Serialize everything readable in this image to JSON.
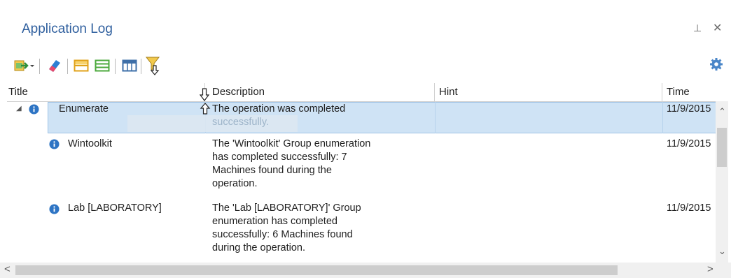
{
  "panel": {
    "title": "Application Log",
    "pin_glyph": "⊥",
    "close_glyph": "✕"
  },
  "toolbar": {
    "items": [
      "export-icon",
      "dropdown-arrow-icon",
      "eraser-icon",
      "collapse-rows-icon",
      "expand-rows-icon",
      "columns-icon",
      "filter-icon"
    ],
    "settings_icon": "gear-icon"
  },
  "grid": {
    "columns": {
      "title": "Title",
      "description": "Description",
      "hint": "Hint",
      "time": "Time"
    },
    "rows": [
      {
        "level": 0,
        "expanded": true,
        "selected": true,
        "icon": "info-icon",
        "title": "Enumerate",
        "description": [
          "The operation was completed",
          "successfully."
        ],
        "hint": "",
        "time": "11/9/2015"
      },
      {
        "level": 1,
        "icon": "info-icon",
        "title": "Wintoolkit",
        "description": [
          "The 'Wintoolkit' Group enumeration",
          "has completed successfully: 7",
          "Machines found during the",
          "operation."
        ],
        "hint": "",
        "time": "11/9/2015"
      },
      {
        "level": 1,
        "icon": "info-icon",
        "title": "Lab [LABORATORY]",
        "description": [
          "The 'Lab [LABORATORY]' Group",
          "enumeration has completed",
          "successfully: 6 Machines found",
          "during the operation."
        ],
        "hint": "",
        "time": "11/9/2015"
      }
    ]
  },
  "colors": {
    "title": "#2f5f9e",
    "selection": "#cfe3f5",
    "info": "#2d74c4"
  }
}
